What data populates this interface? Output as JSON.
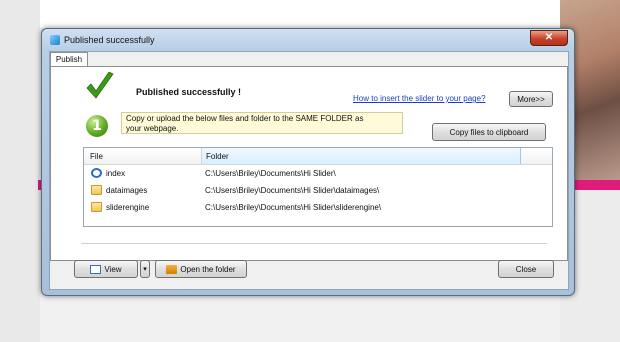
{
  "window": {
    "title": "Published successfully",
    "close_glyph": "✕"
  },
  "tab": {
    "label": "Publish"
  },
  "header": {
    "headline": "Published successfully !",
    "help_link": "How to insert the slider to your page?",
    "more_button": "More>>",
    "step_number": "1",
    "note_line1": "Copy or upload the below files and folder to the SAME FOLDER as",
    "note_line2": "your webpage.",
    "copy_button": "Copy files to clipboard"
  },
  "filelist": {
    "columns": [
      "File",
      "Folder"
    ],
    "rows": [
      {
        "icon": "ie-icon",
        "name": "index",
        "folder": "C:\\Users\\Briley\\Documents\\Hi Slider\\"
      },
      {
        "icon": "folder-icon",
        "name": "dataimages",
        "folder": "C:\\Users\\Briley\\Documents\\Hi Slider\\dataimages\\"
      },
      {
        "icon": "folder-icon",
        "name": "sliderengine",
        "folder": "C:\\Users\\Briley\\Documents\\Hi Slider\\sliderengine\\"
      }
    ]
  },
  "footer": {
    "view_button": "View",
    "dropdown_glyph": "▾",
    "open_folder_button": "Open the folder",
    "close_button": "Close"
  },
  "colors": {
    "accent_link": "#1b3ec6",
    "title_bg": "#b8cfe6",
    "close_red": "#c8412a"
  }
}
